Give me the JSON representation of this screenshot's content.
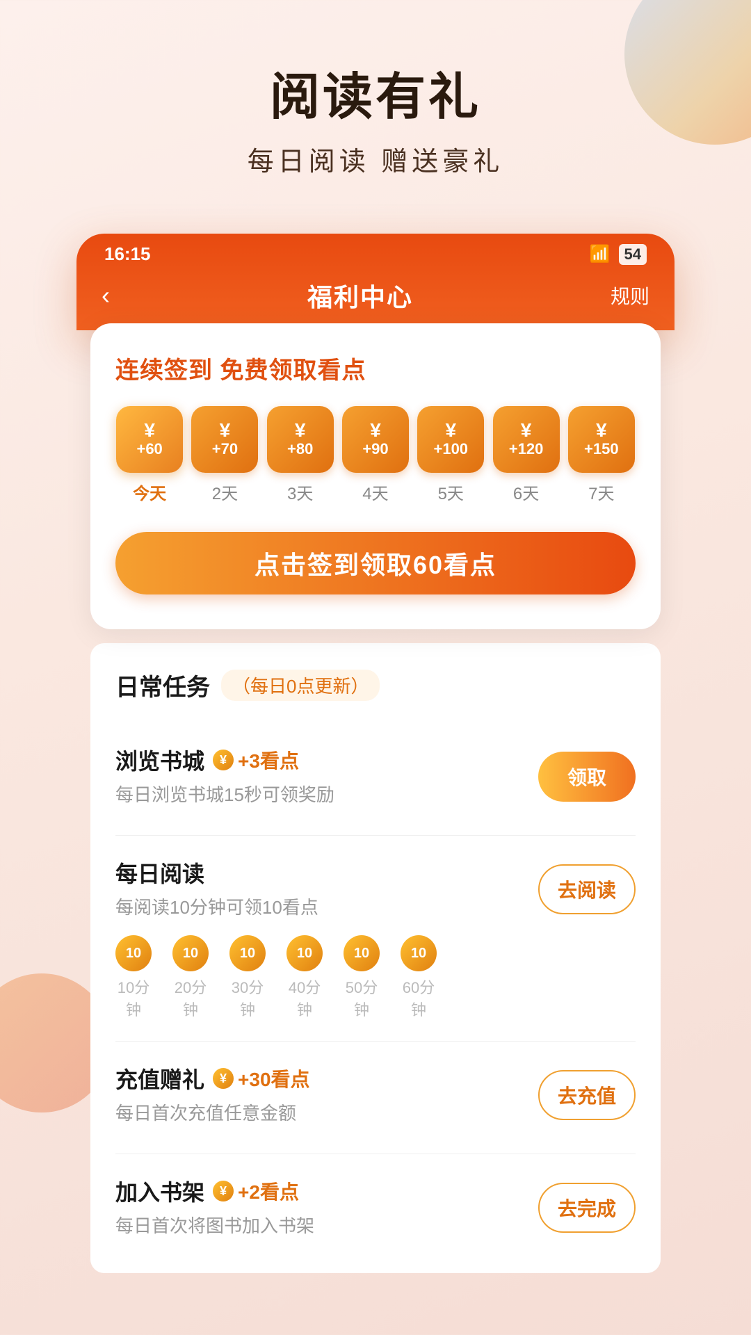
{
  "page": {
    "title": "阅读有礼",
    "subtitle": "每日阅读 赠送豪礼"
  },
  "statusBar": {
    "time": "16:15",
    "battery": "54"
  },
  "nav": {
    "back": "‹",
    "title": "福利中心",
    "rules": "规则"
  },
  "signin": {
    "title": "连续签到 免费领取看点",
    "days": [
      {
        "amount": "+60",
        "label": "今天",
        "isToday": true
      },
      {
        "amount": "+70",
        "label": "2天",
        "isToday": false
      },
      {
        "amount": "+80",
        "label": "3天",
        "isToday": false
      },
      {
        "amount": "+90",
        "label": "4天",
        "isToday": false
      },
      {
        "amount": "+100",
        "label": "5天",
        "isToday": false
      },
      {
        "amount": "+120",
        "label": "6天",
        "isToday": false
      },
      {
        "amount": "+150",
        "label": "7天",
        "isToday": false
      }
    ],
    "coinSymbol": "¥",
    "btnLabel": "点击签到领取60看点"
  },
  "tasks": {
    "title": "日常任务",
    "updateNote": "（每日0点更新）",
    "items": [
      {
        "name": "浏览书城",
        "rewardText": "+3看点",
        "desc": "每日浏览书城15秒可领奖励",
        "btnLabel": "领取",
        "btnFilled": true,
        "showProgress": false
      },
      {
        "name": "每日阅读",
        "rewardText": "",
        "desc": "每阅读10分钟可领10看点",
        "btnLabel": "去阅读",
        "btnFilled": false,
        "showProgress": true,
        "progress": {
          "coins": [
            "10",
            "10",
            "10",
            "10",
            "10",
            "10"
          ],
          "times": [
            "10分钟",
            "20分钟",
            "30分钟",
            "40分钟",
            "50分钟",
            "60分钟"
          ]
        }
      },
      {
        "name": "充值赠礼",
        "rewardText": "+30看点",
        "desc": "每日首次充值任意金额",
        "btnLabel": "去充值",
        "btnFilled": false,
        "showProgress": false
      },
      {
        "name": "加入书架",
        "rewardText": "+2看点",
        "desc": "每日首次将图书加入书架",
        "btnLabel": "去完成",
        "btnFilled": false,
        "showProgress": false
      }
    ]
  }
}
